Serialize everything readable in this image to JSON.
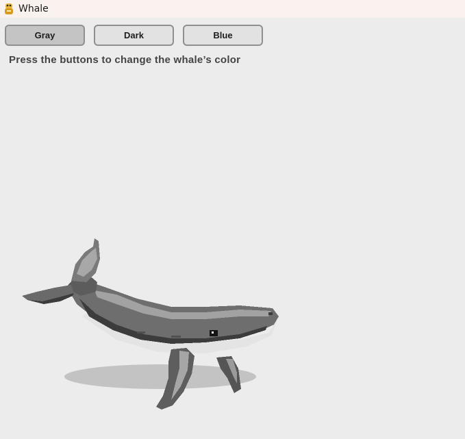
{
  "window": {
    "title": "Whale"
  },
  "buttons": [
    {
      "label": "Gray",
      "selected": true
    },
    {
      "label": "Dark",
      "selected": false
    },
    {
      "label": "Blue",
      "selected": false
    }
  ],
  "instructions": "Press the buttons to change the whale’s color",
  "colors": {
    "background": "#ececec",
    "titlebar": "#f9f2ee",
    "button_face": "#e2e2e2",
    "button_selected": "#c4c4c4",
    "button_border": "#8f8f8f",
    "whale_body": "#6e6e6e",
    "whale_dark": "#3c3c3c",
    "whale_light": "#a2a2a2",
    "whale_belly": "#e4e4e4",
    "shadow": "#c3c3c3"
  },
  "whale": {
    "color_mode": "Gray"
  }
}
